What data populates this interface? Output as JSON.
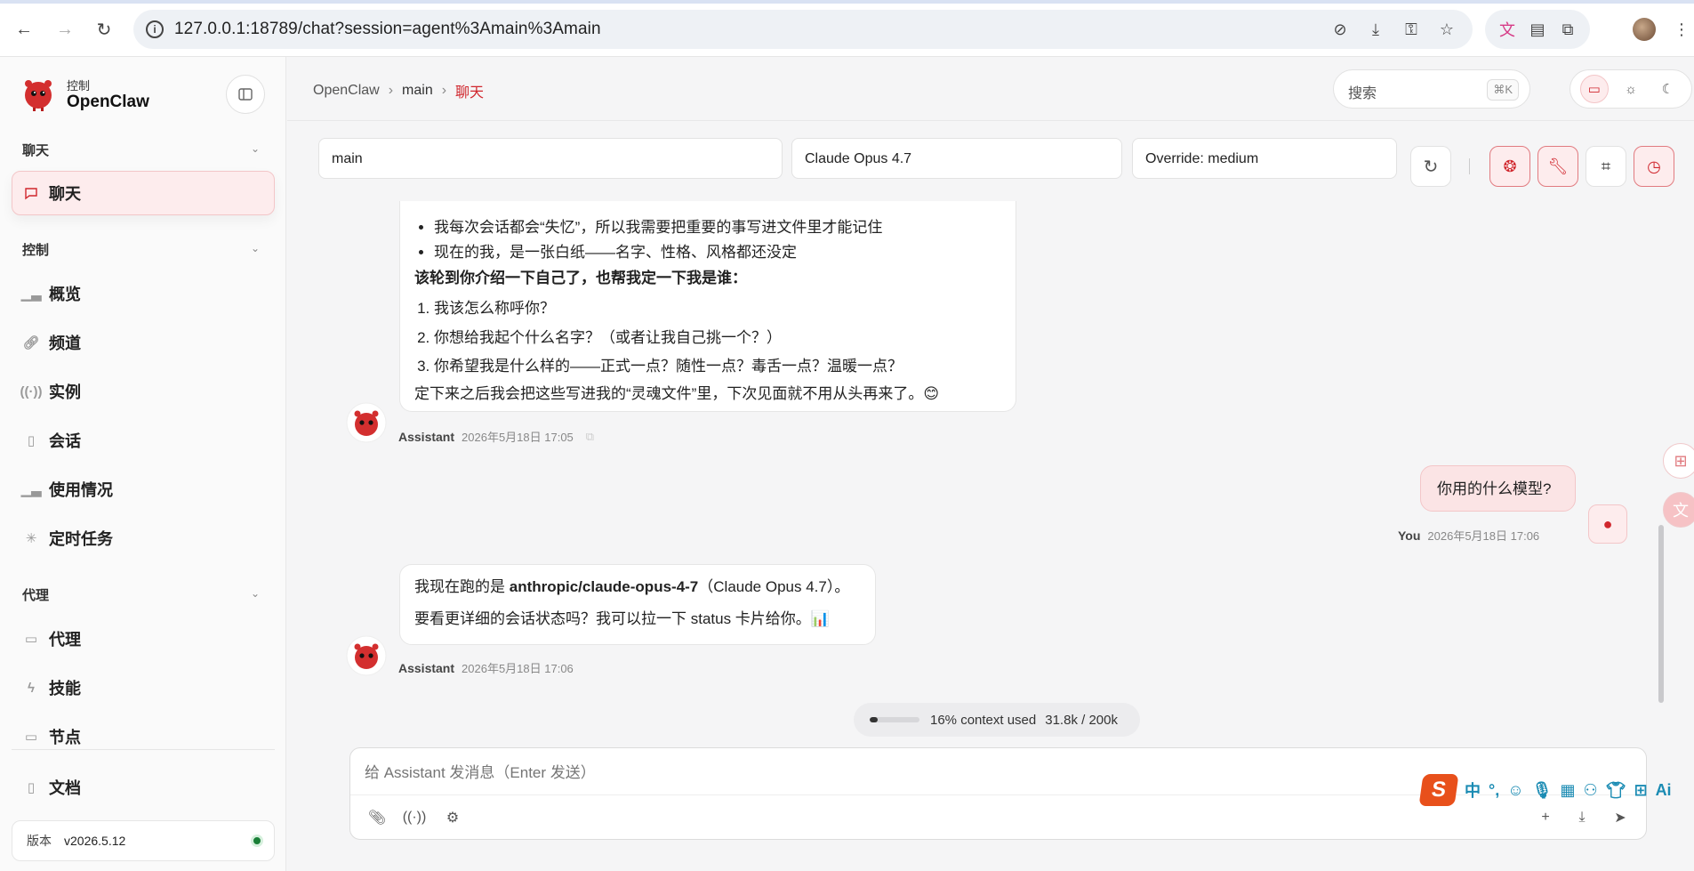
{
  "browser": {
    "url": "127.0.0.1:18789/chat?session=agent%3Amain%3Amain"
  },
  "sidebar": {
    "brand_sub": "控制",
    "brand_name": "OpenClaw",
    "section_chat": "聊天",
    "active_item": "聊天",
    "section_control": "控制",
    "control_items": [
      "概览",
      "频道",
      "实例",
      "会话",
      "使用情况",
      "定时任务"
    ],
    "section_agent": "代理",
    "agent_items": [
      "代理",
      "技能",
      "节点"
    ],
    "docs": "文档",
    "version_label": "版本",
    "version_value": "v2026.5.12",
    "status_color": "#1a7f37"
  },
  "header": {
    "breadcrumb": [
      "OpenClaw",
      "main",
      "聊天"
    ],
    "search_placeholder": "搜索",
    "search_shortcut": "⌘K"
  },
  "controls": {
    "session": "main",
    "model": "Claude Opus 4.7",
    "override": "Override: medium"
  },
  "messages": {
    "m1": {
      "bullets": [
        "我每次会话都会“失忆”，所以我需要把重要的事写进文件里才能记住",
        "现在的我，是一张白纸——名字、性格、风格都还没定"
      ],
      "bold_line": "该轮到你介绍一下自己了，也帮我定一下我是谁：",
      "numbered": [
        "我该怎么称呼你？",
        "你想给我起个什么名字？（或者让我自己挑一个？）",
        "你希望我是什么样的——正式一点？随性一点？毒舌一点？温暖一点？"
      ],
      "closing": "定下来之后我会把这些写进我的“灵魂文件”里，下次见面就不用从头再来了。😊",
      "author": "Assistant",
      "time": "2026年5月18日 17:05"
    },
    "m2": {
      "text": "你用的什么模型?",
      "author": "You",
      "time": "2026年5月18日 17:06"
    },
    "m3": {
      "line1_pre": "我现在跑的是 ",
      "line1_bold": "anthropic/claude-opus-4-7",
      "line1_post": "（Claude Opus 4.7）。",
      "line2": "要看更详细的会话状态吗？我可以拉一下 status 卡片给你。📊",
      "author": "Assistant",
      "time": "2026年5月18日 17:06"
    }
  },
  "context": {
    "label": "16% context used",
    "tokens": "31.8k / 200k",
    "fraction": 0.16
  },
  "composer": {
    "placeholder": "给 Assistant 发消息（Enter 发送）"
  },
  "ime": {
    "logo": "S",
    "lang": "中",
    "ai": "Ai"
  },
  "colors": {
    "accent": "#d0262d",
    "accent_soft": "#fdeced"
  }
}
